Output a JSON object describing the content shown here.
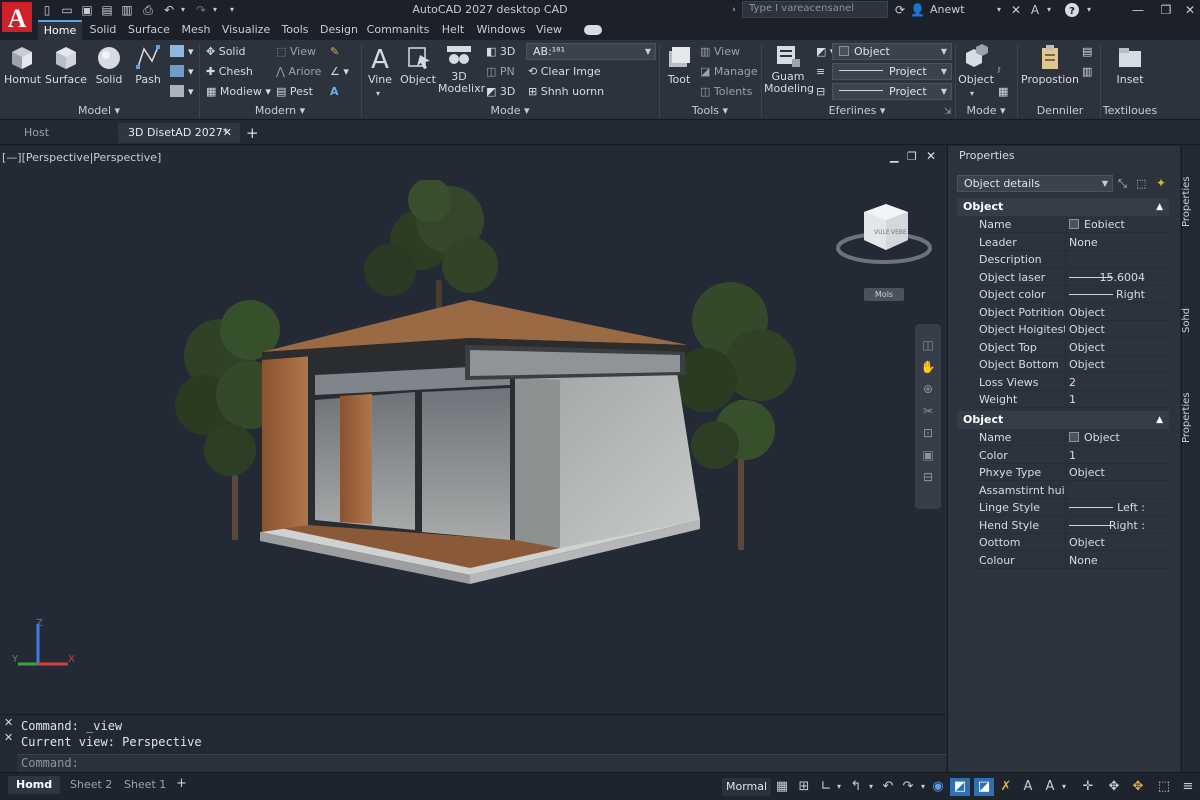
{
  "app": {
    "title": "AutoCAD 2027 desktop CAD",
    "search_placeholder": "Type I vareacensanel",
    "user_name": "Anewt",
    "accent_color": "#5aa0e6",
    "logo_color": "#d0202a"
  },
  "menu_tabs": [
    "Home",
    "Solid",
    "Surface",
    "Mesh",
    "Visualize",
    "Tools",
    "Design",
    "Commanits",
    "Helt",
    "Windows",
    "View"
  ],
  "ribbon": {
    "model": {
      "group": "Model",
      "buttons": [
        "Homut",
        "Surface",
        "Solid",
        "Pash"
      ]
    },
    "modern": {
      "group": "Modern",
      "items": [
        "Solid",
        "Chesh",
        "Modiew",
        "View",
        "Ariore",
        "Pest"
      ]
    },
    "mode": {
      "group": "Mode",
      "buttons": [
        "Vine",
        "Object",
        "3D Modelixr"
      ],
      "small": [
        "3D",
        "PN",
        "3D"
      ],
      "combo": "AB:¹⁸¹",
      "actions": [
        "Clear Imge",
        "Shnh uornn"
      ]
    },
    "tools": {
      "group": "Tools",
      "button": "Toot",
      "items": [
        "View",
        "Manage",
        "Tolents"
      ]
    },
    "eferiines": {
      "group": "Eferiines",
      "button": "Guam Modeling",
      "combos": [
        "Object",
        "Project",
        "Project"
      ]
    },
    "mode2": {
      "group": "Mode",
      "button": "Object"
    },
    "denniler": {
      "group": "Denniler",
      "button": "Propostion"
    },
    "textiloues": {
      "group": "Textiloues",
      "button": "Inset"
    }
  },
  "doc_tabs": [
    "Host",
    "3D DisetAD 2027*"
  ],
  "viewport": {
    "label": "[—][Perspective|Perspective]",
    "viewcube_faces": [
      "VULE",
      "VEBE"
    ],
    "viewcube_tag": "Mols"
  },
  "properties": {
    "title": "Properties",
    "selector": "Object details",
    "section1": {
      "title": "Object",
      "rows": [
        {
          "name": "Name",
          "value": "Eobiect",
          "swatch": true
        },
        {
          "name": "Leader",
          "value": "None"
        },
        {
          "name": "Description",
          "value": ""
        },
        {
          "name": "Object laser",
          "value": "15.6004",
          "line": true
        },
        {
          "name": "Object color",
          "value": "Right",
          "line": true
        },
        {
          "name": "Object Potrition",
          "value": "Object"
        },
        {
          "name": "Object Hoigitestion",
          "value": "Object"
        },
        {
          "name": "Object Top",
          "value": "Object"
        },
        {
          "name": "Object Bottom",
          "value": "Object"
        },
        {
          "name": "Loss Views",
          "value": "2"
        },
        {
          "name": "Weight",
          "value": "1"
        }
      ]
    },
    "section2": {
      "title": "Object",
      "rows": [
        {
          "name": "Name",
          "value": "Object",
          "swatch": true
        },
        {
          "name": "Color",
          "value": "1"
        },
        {
          "name": "Phxye Type",
          "value": "Object"
        },
        {
          "name": "Assamstirnt huion",
          "value": ""
        },
        {
          "name": "Linge Style",
          "value": "Left :",
          "line": true
        },
        {
          "name": "Hend Style",
          "value": "Right :",
          "line": true
        },
        {
          "name": "Oottom",
          "value": "Object"
        },
        {
          "name": "Colour",
          "value": "None"
        }
      ]
    },
    "side_tabs": [
      "Properties",
      "Sohd",
      "Properties"
    ]
  },
  "command": {
    "lines": [
      "Command: _view",
      "Current view: Perspective"
    ],
    "prompt": "Command:"
  },
  "status": {
    "layouts": [
      "Homd",
      "Sheet 2",
      "Sheet 1"
    ],
    "mode_label": "Mormal"
  }
}
